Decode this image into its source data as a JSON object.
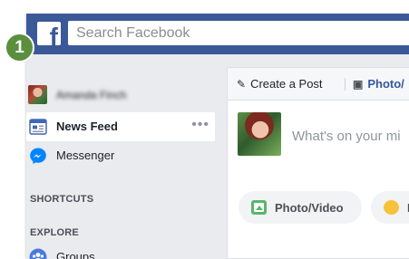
{
  "header": {
    "logo_letter": "f",
    "search_placeholder": "Search Facebook"
  },
  "callout": {
    "number": "1"
  },
  "sidebar": {
    "profile_name": "Amanda Finch",
    "items": [
      {
        "label": "News Feed",
        "icon": "news-feed-icon",
        "more": "•••"
      },
      {
        "label": "Messenger",
        "icon": "messenger-icon"
      },
      {
        "label": "Groups",
        "icon": "groups-icon"
      }
    ],
    "sections": {
      "shortcuts": "SHORTCUTS",
      "explore": "EXPLORE"
    }
  },
  "composer": {
    "tabs": {
      "create_post": "Create a Post",
      "photo": "Photo/"
    },
    "prompt": "What's on your mi",
    "actions": {
      "photo_video": "Photo/Video",
      "feeling": "F"
    }
  },
  "colors": {
    "brand_blue": "#3b5998",
    "page_bg": "#e9ebee",
    "callout_green": "#5a8f3e"
  }
}
